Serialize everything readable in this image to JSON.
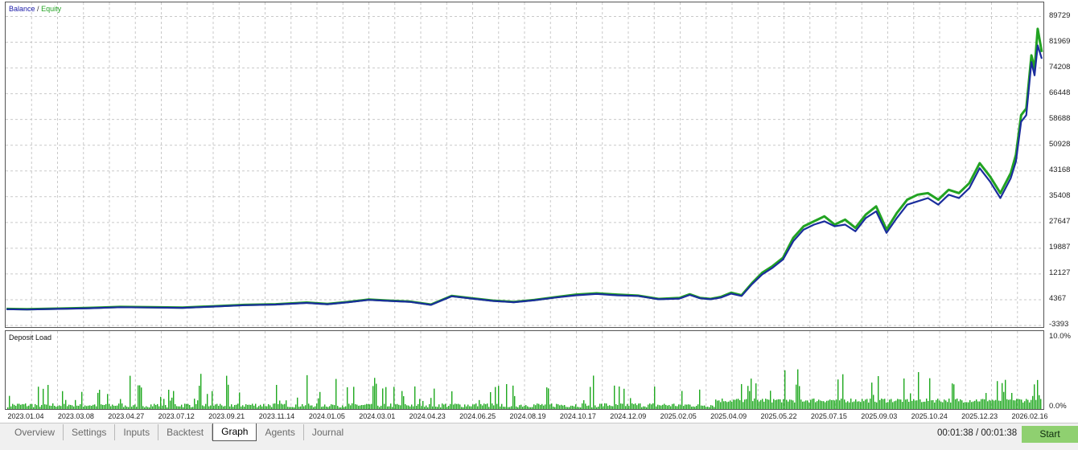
{
  "legend": {
    "balance": "Balance",
    "separator": "/",
    "equity": "Equity"
  },
  "deposit_load_title": "Deposit Load",
  "colors": {
    "balance": "#1a2d9c",
    "equity": "#22a322",
    "load_bar": "#1fa81f",
    "grid": "#c9c9c9"
  },
  "tabs": [
    "Overview",
    "Settings",
    "Inputs",
    "Backtest",
    "Graph",
    "Agents",
    "Journal"
  ],
  "active_tab": "Graph",
  "timer": "00:01:38 / 00:01:38",
  "start_label": "Start",
  "chart_data": [
    {
      "type": "line",
      "ylim": [
        -3393,
        93000
      ],
      "y_ticks": [
        "89729",
        "81969",
        "74208",
        "66448",
        "58688",
        "50928",
        "43168",
        "35408",
        "27647",
        "19887",
        "12127",
        "4367",
        "-3393"
      ],
      "x_tick_labels": [
        "2023.01.04",
        "2023.03.08",
        "2023.04.27",
        "2023.07.12",
        "2023.09.21",
        "2023.11.14",
        "2024.01.05",
        "2024.03.01",
        "2024.04.23",
        "2024.06.25",
        "2024.08.19",
        "2024.10.17",
        "2024.12.09",
        "2025.02.05",
        "2025.04.09",
        "2025.05.22",
        "2025.07.15",
        "2025.09.03",
        "2025.10.24",
        "2025.12.23",
        "2026.02.16"
      ],
      "series": [
        {
          "name": "Balance",
          "x": [
            0,
            0.02,
            0.05,
            0.08,
            0.11,
            0.14,
            0.17,
            0.2,
            0.23,
            0.26,
            0.29,
            0.31,
            0.33,
            0.35,
            0.37,
            0.39,
            0.41,
            0.43,
            0.45,
            0.47,
            0.49,
            0.51,
            0.53,
            0.55,
            0.57,
            0.59,
            0.61,
            0.63,
            0.65,
            0.66,
            0.67,
            0.68,
            0.69,
            0.7,
            0.71,
            0.72,
            0.73,
            0.74,
            0.75,
            0.76,
            0.77,
            0.78,
            0.79,
            0.8,
            0.81,
            0.82,
            0.83,
            0.84,
            0.85,
            0.86,
            0.87,
            0.88,
            0.89,
            0.9,
            0.91,
            0.92,
            0.93,
            0.94,
            0.95,
            0.96,
            0.97,
            0.975,
            0.98,
            0.985,
            0.99,
            0.993,
            0.996,
            1.0
          ],
          "values": [
            1500,
            1400,
            1600,
            1800,
            2100,
            2000,
            1900,
            2300,
            2700,
            2900,
            3400,
            3000,
            3600,
            4300,
            4000,
            3700,
            2800,
            5400,
            4700,
            4000,
            3600,
            4200,
            5000,
            5700,
            6100,
            5700,
            5500,
            4500,
            4700,
            5800,
            4800,
            4500,
            5000,
            6200,
            5500,
            9000,
            12000,
            14000,
            16500,
            22000,
            25500,
            27000,
            28000,
            26500,
            27000,
            25000,
            29000,
            31000,
            24500,
            29000,
            33000,
            34000,
            35000,
            33000,
            36000,
            35000,
            38000,
            44000,
            40000,
            35000,
            41000,
            46000,
            58000,
            60000,
            76000,
            72000,
            81000,
            77000
          ]
        },
        {
          "name": "Equity",
          "x": [
            0,
            0.02,
            0.05,
            0.08,
            0.11,
            0.14,
            0.17,
            0.2,
            0.23,
            0.26,
            0.29,
            0.31,
            0.33,
            0.35,
            0.37,
            0.39,
            0.41,
            0.43,
            0.45,
            0.47,
            0.49,
            0.51,
            0.53,
            0.55,
            0.57,
            0.59,
            0.61,
            0.63,
            0.65,
            0.66,
            0.67,
            0.68,
            0.69,
            0.7,
            0.71,
            0.72,
            0.73,
            0.74,
            0.75,
            0.76,
            0.77,
            0.78,
            0.79,
            0.8,
            0.81,
            0.82,
            0.83,
            0.84,
            0.85,
            0.86,
            0.87,
            0.88,
            0.89,
            0.9,
            0.91,
            0.92,
            0.93,
            0.94,
            0.95,
            0.96,
            0.97,
            0.975,
            0.98,
            0.985,
            0.99,
            0.993,
            0.996,
            1.0
          ],
          "values": [
            1600,
            1500,
            1700,
            1900,
            2200,
            2100,
            2000,
            2400,
            2800,
            3000,
            3500,
            3100,
            3700,
            4400,
            4100,
            3800,
            2900,
            5500,
            4800,
            4100,
            3700,
            4300,
            5100,
            5900,
            6300,
            5900,
            5600,
            4600,
            4900,
            6000,
            4900,
            4600,
            5200,
            6500,
            5700,
            9300,
            12500,
            14500,
            17000,
            23000,
            26500,
            28000,
            29500,
            27000,
            28500,
            26000,
            30000,
            32500,
            25500,
            30500,
            34500,
            36000,
            36500,
            34500,
            37500,
            36500,
            39500,
            45500,
            41500,
            36500,
            42500,
            48000,
            60000,
            62000,
            78000,
            74000,
            86000,
            79000
          ]
        }
      ]
    },
    {
      "type": "bar",
      "title": "Deposit Load",
      "ylim": [
        0,
        10
      ],
      "y_ticks": [
        "10.0%",
        "0.0%"
      ]
    }
  ]
}
